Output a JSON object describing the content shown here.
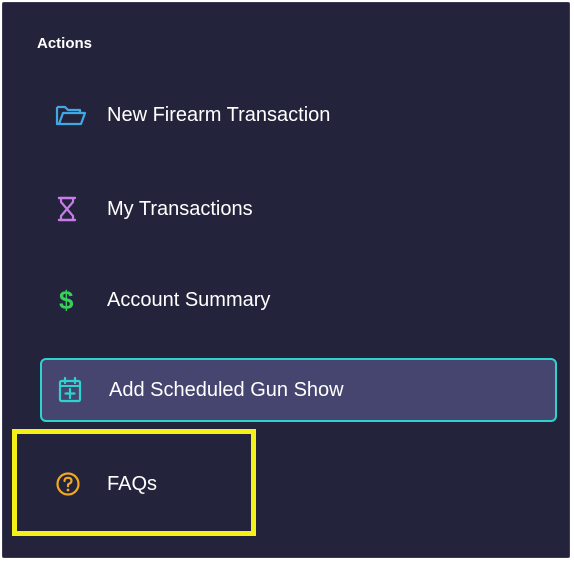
{
  "section": {
    "title": "Actions"
  },
  "menu": {
    "items": [
      {
        "label": "New Firearm Transaction",
        "icon": "folder-open-icon"
      },
      {
        "label": "My Transactions",
        "icon": "hourglass-icon"
      },
      {
        "label": "Account Summary",
        "icon": "dollar-icon",
        "glyph": "$"
      },
      {
        "label": "Add Scheduled Gun Show",
        "icon": "calendar-plus-icon",
        "active": true
      },
      {
        "label": "FAQs",
        "icon": "question-circle-icon",
        "highlighted": true
      }
    ]
  },
  "colors": {
    "panel_bg": "#23233b",
    "active_bg": "#464570",
    "active_border": "#2ed3d0",
    "highlight": "#f4f11a",
    "folder_icon": "#41a8e6",
    "hourglass_icon": "#c77de8",
    "dollar_icon": "#35d05b",
    "calendar_icon": "#2ed3d0",
    "faq_icon": "#f0a81f"
  }
}
